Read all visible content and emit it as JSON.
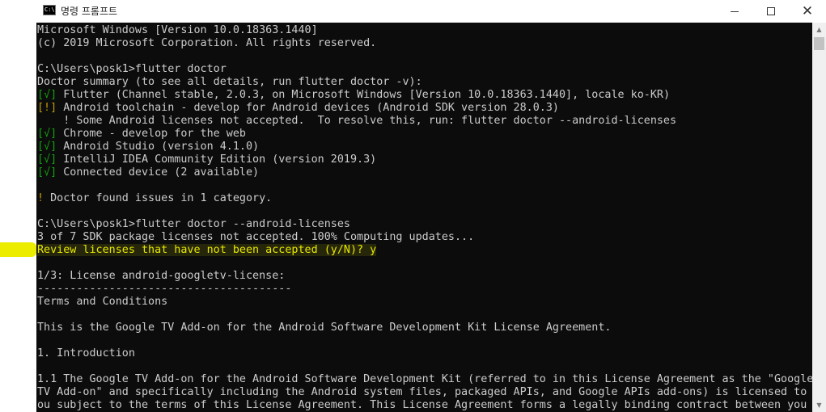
{
  "window": {
    "title": "명령 프롬프트",
    "icon_text": "C:\\",
    "minimize_icon": "minimize-icon",
    "maximize_icon": "maximize-icon",
    "close_glyph": "✕"
  },
  "colors": {
    "background": "#0c0c0c",
    "text": "#cccccc",
    "yellow": "#c19c00",
    "green": "#13a10e",
    "highlight": "#e8e800"
  },
  "console": {
    "lines": [
      {
        "segments": [
          {
            "text": "Microsoft Windows [Version 10.0.18363.1440]"
          }
        ]
      },
      {
        "segments": [
          {
            "text": "(c) 2019 Microsoft Corporation. All rights reserved."
          }
        ]
      },
      {
        "segments": [
          {
            "text": ""
          }
        ]
      },
      {
        "segments": [
          {
            "text": "C:\\Users\\posk1>flutter doctor"
          }
        ]
      },
      {
        "segments": [
          {
            "text": "Doctor summary (to see all details, run flutter doctor -v):"
          }
        ]
      },
      {
        "segments": [
          {
            "text": "[√]",
            "color": "green"
          },
          {
            "text": " Flutter (Channel stable, 2.0.3, on Microsoft Windows [Version 10.0.18363.1440], locale ko-KR)"
          }
        ]
      },
      {
        "segments": [
          {
            "text": "[!]",
            "color": "yellow"
          },
          {
            "text": " Android toolchain - develop for Android devices (Android SDK version 28.0.3)"
          }
        ]
      },
      {
        "segments": [
          {
            "text": "    ! Some Android licenses not accepted.  To resolve this, run: flutter doctor --android-licenses"
          }
        ]
      },
      {
        "segments": [
          {
            "text": "[√]",
            "color": "green"
          },
          {
            "text": " Chrome - develop for the web"
          }
        ]
      },
      {
        "segments": [
          {
            "text": "[√]",
            "color": "green"
          },
          {
            "text": " Android Studio (version 4.1.0)"
          }
        ]
      },
      {
        "segments": [
          {
            "text": "[√]",
            "color": "green"
          },
          {
            "text": " IntelliJ IDEA Community Edition (version 2019.3)"
          }
        ]
      },
      {
        "segments": [
          {
            "text": "[√]",
            "color": "green"
          },
          {
            "text": " Connected device (2 available)"
          }
        ]
      },
      {
        "segments": [
          {
            "text": ""
          }
        ]
      },
      {
        "segments": [
          {
            "text": "!",
            "color": "yellow"
          },
          {
            "text": " Doctor found issues in 1 category."
          }
        ]
      },
      {
        "segments": [
          {
            "text": ""
          }
        ]
      },
      {
        "segments": [
          {
            "text": "C:\\Users\\posk1>flutter doctor --android-licenses"
          }
        ]
      },
      {
        "segments": [
          {
            "text": "3 of 7 SDK package licenses not accepted. 100% Computing updates..."
          }
        ]
      },
      {
        "highlight": true,
        "segments": [
          {
            "text": "Review licenses that have not been accepted (y/N)? y"
          }
        ]
      },
      {
        "segments": [
          {
            "text": ""
          }
        ]
      },
      {
        "segments": [
          {
            "text": "1/3: License android-googletv-license:"
          }
        ]
      },
      {
        "segments": [
          {
            "text": "---------------------------------------"
          }
        ]
      },
      {
        "segments": [
          {
            "text": "Terms and Conditions"
          }
        ]
      },
      {
        "segments": [
          {
            "text": ""
          }
        ]
      },
      {
        "segments": [
          {
            "text": "This is the Google TV Add-on for the Android Software Development Kit License Agreement."
          }
        ]
      },
      {
        "segments": [
          {
            "text": ""
          }
        ]
      },
      {
        "segments": [
          {
            "text": "1. Introduction"
          }
        ]
      },
      {
        "segments": [
          {
            "text": ""
          }
        ]
      },
      {
        "segments": [
          {
            "text": "1.1 The Google TV Add-on for the Android Software Development Kit (referred to in this License Agreement as the \"Google"
          }
        ]
      },
      {
        "segments": [
          {
            "text": "TV Add-on\" and specifically including the Android system files, packaged APIs, and Google APIs add-ons) is licensed to y"
          }
        ]
      },
      {
        "segments": [
          {
            "text": "ou subject to the terms of this License Agreement. This License Agreement forms a legally binding contract between you a"
          }
        ]
      }
    ]
  },
  "scrollbar": {
    "up_glyph": "▲",
    "down_glyph": "▼"
  }
}
